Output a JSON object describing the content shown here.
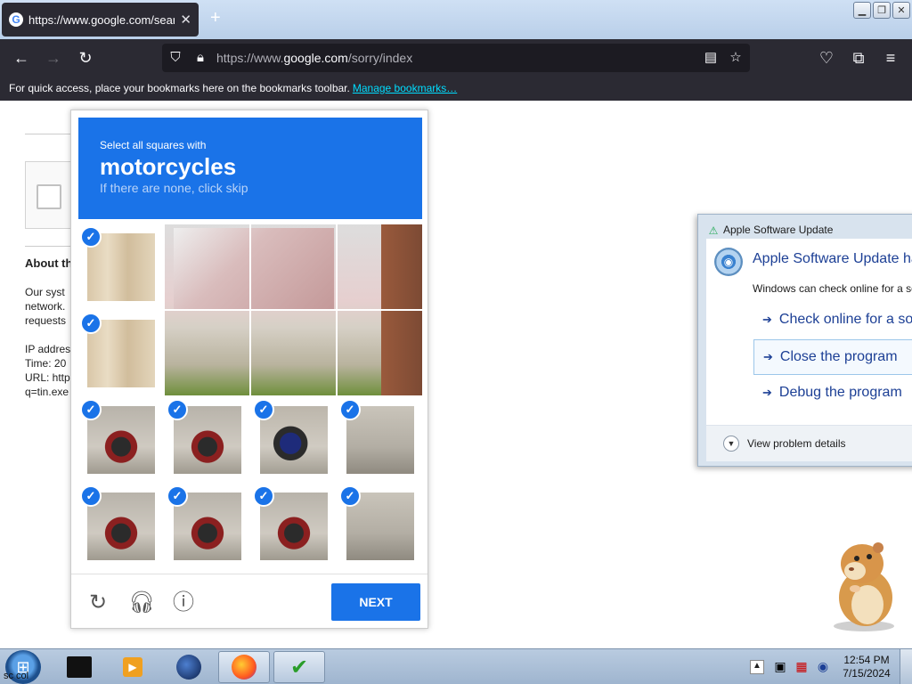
{
  "browser": {
    "tab_title": "https://www.google.com/search",
    "tab_close": "✕",
    "new_tab": "+",
    "url_prefix": "https://www.",
    "url_domain": "google.com",
    "url_path": "/sorry/index",
    "bookmarks_text": "For quick access, place your bookmarks here on the bookmarks toolbar.",
    "bookmarks_link": "Manage bookmarks…"
  },
  "page": {
    "heading": "About th",
    "lines": [
      "Our syst",
      "network.",
      "requests",
      "",
      "IP addres",
      "Time: 20",
      "URL: http",
      "q=tin.exe"
    ]
  },
  "captcha": {
    "instruction": "Select all squares with",
    "target": "motorcycles",
    "hint": "If there are none, click skip",
    "next_label": "NEXT",
    "check_glyph": "✓"
  },
  "dialog": {
    "title": "Apple Software Update",
    "heading": "Apple Software Update ha",
    "subtext": "Windows can check online for a so",
    "options": [
      "Check online for a sol",
      "Close the program",
      "Debug the program"
    ],
    "details_label": "View problem details"
  },
  "taskbar": {
    "start_label": "sc col",
    "time": "12:54 PM",
    "date": "7/15/2024"
  },
  "icons": {
    "tab_favicon": "google-g",
    "accent": "#1a73e8"
  }
}
